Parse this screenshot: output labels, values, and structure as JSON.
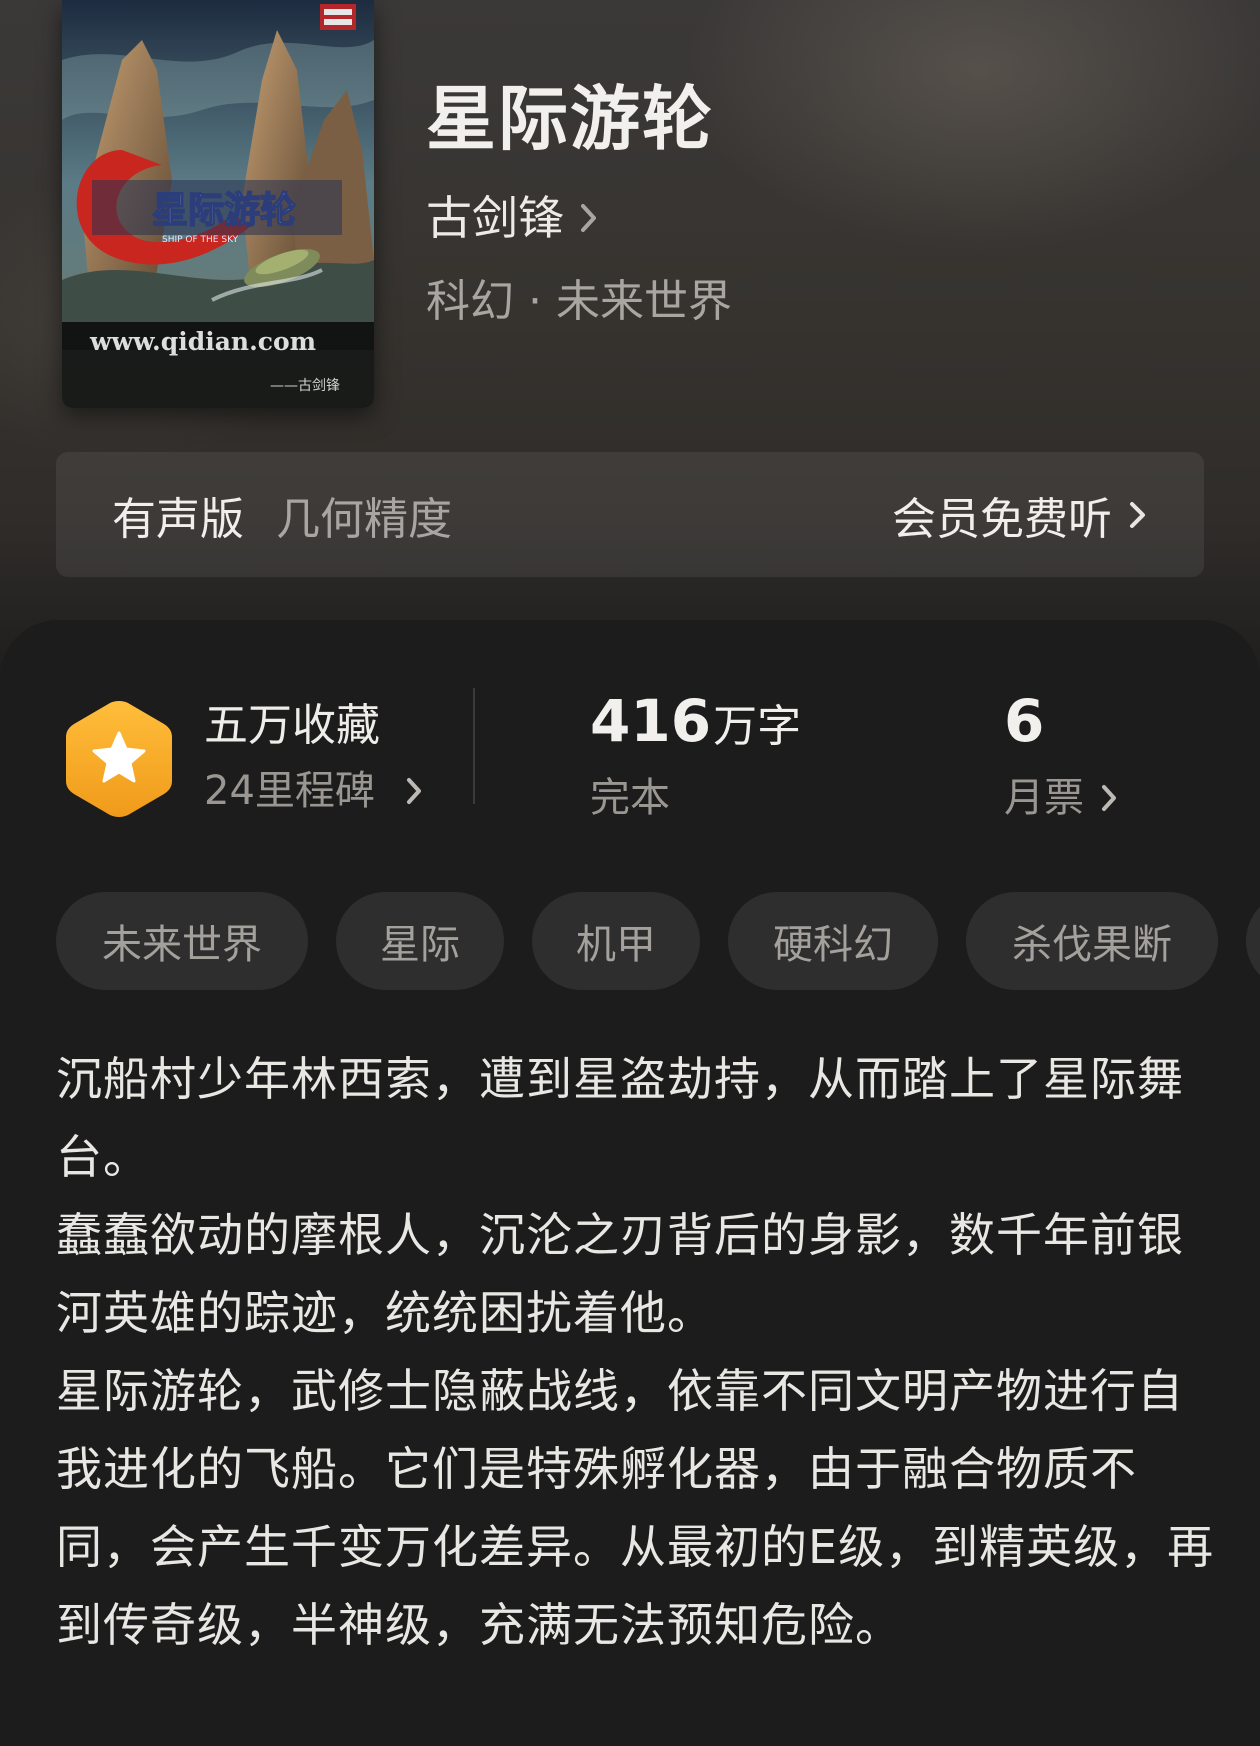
{
  "book": {
    "title": "星际游轮",
    "author": "古剑锋",
    "genre": "科幻 · 未来世界",
    "cover": {
      "title_text": "星际游轮",
      "subtitle_text": "SHIP OF THE SKY",
      "url_text": "www.qidian.com",
      "author_text": "——古剑锋"
    }
  },
  "audio": {
    "label": "有声版",
    "narrator": "几何精度",
    "action": "会员免费听"
  },
  "stats": {
    "favorites": "五万收藏",
    "milestone": "24里程碑",
    "word_count": "416",
    "word_unit": "万字",
    "status": "完本",
    "monthly_tickets": "6",
    "monthly_label": "月票"
  },
  "tags": [
    "未来世界",
    "星际",
    "机甲",
    "硬科幻",
    "杀伐果断"
  ],
  "description": {
    "paragraphs": [
      "沉船村少年林西索，遭到星盗劫持，从而踏上了星际舞台。",
      "蠢蠢欲动的摩根人，沉沦之刃背后的身影，数千年前银河英雄的踪迹，统统困扰着他。",
      "星际游轮，武修士隐蔽战线，依靠不同文明产物进行自我进化的飞船。它们是特殊孵化器，由于融合物质不同，会产生千变万化差异。从最初的E级，到精英级，再到传奇级，半神级，充满无法预知危险。"
    ]
  },
  "colors": {
    "badge_orange": "#f5a623",
    "panel_bg": "#1c1c1c",
    "tag_bg": "#2e2e2e"
  },
  "icons": {
    "author_chevron": "chevron-right-icon",
    "badge": "star-hexagon-icon"
  }
}
